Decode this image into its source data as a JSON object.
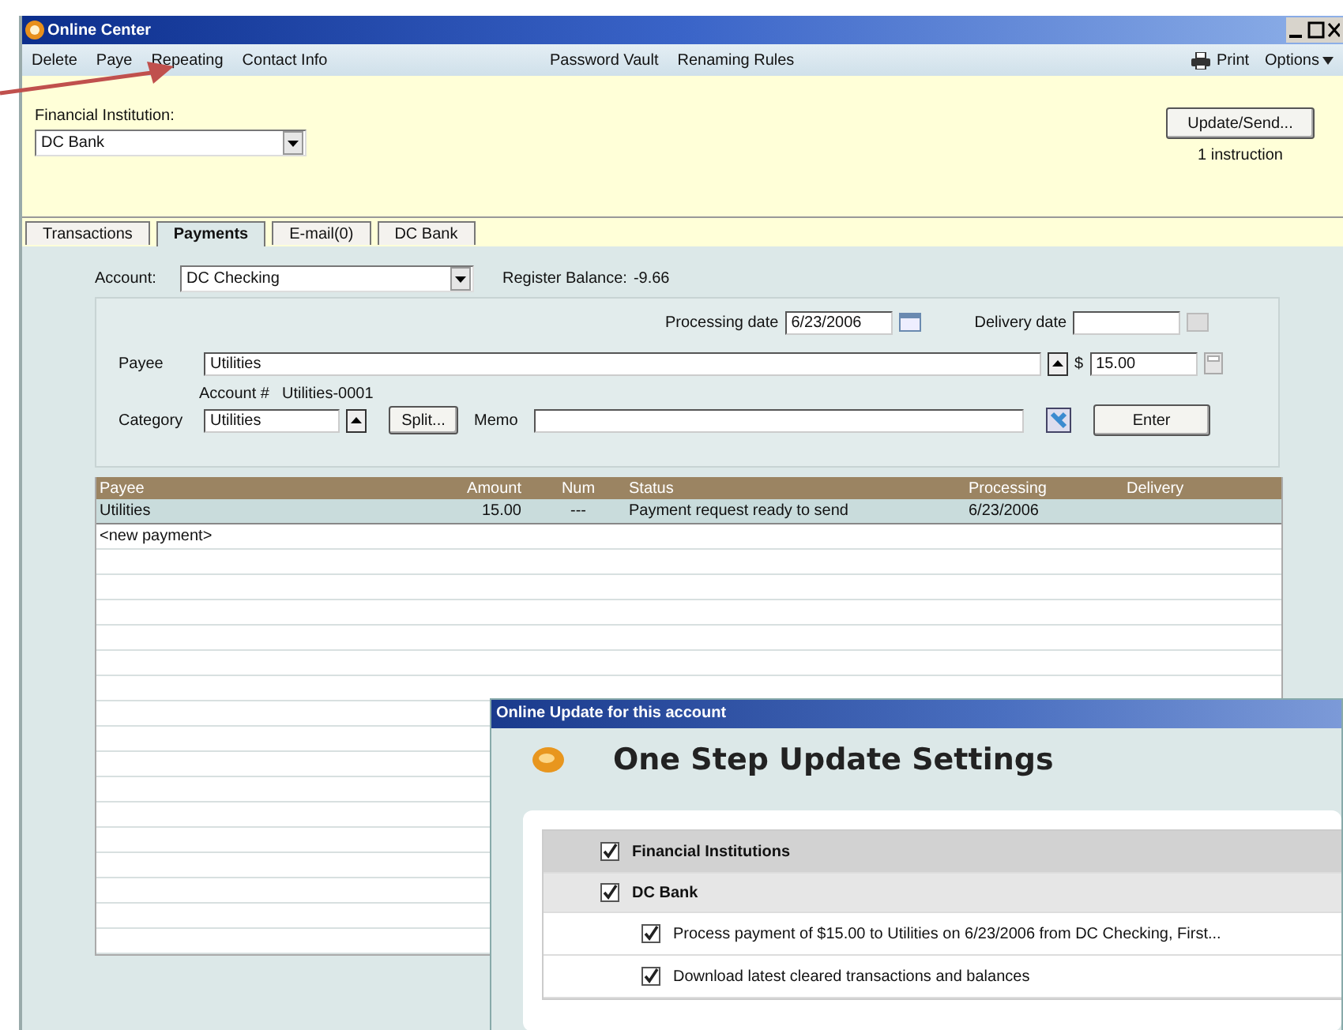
{
  "window": {
    "title": "Online Center"
  },
  "menu": {
    "left": [
      "Delete",
      "Paye",
      "Repeating",
      "Contact Info"
    ],
    "center": [
      "Password Vault",
      "Renaming Rules"
    ],
    "print": "Print",
    "options": "Options"
  },
  "institution": {
    "label": "Financial Institution:",
    "value": "DC Bank"
  },
  "update": {
    "button": "Update/Send...",
    "note": "1 instruction"
  },
  "tabs": [
    {
      "label": "Transactions",
      "selected": false
    },
    {
      "label": "Payments",
      "selected": true
    },
    {
      "label": "E-mail(0)",
      "selected": false
    },
    {
      "label": "DC Bank",
      "selected": false
    }
  ],
  "account": {
    "label": "Account:",
    "value": "DC Checking",
    "balance_label": "Register Balance:",
    "balance": "-9.66"
  },
  "form": {
    "processing_label": "Processing date",
    "processing_date": "6/23/2006",
    "delivery_label": "Delivery date",
    "payee_label": "Payee",
    "payee": "Utilities",
    "currency": "$",
    "amount": "15.00",
    "account_number_label": "Account #",
    "account_number": "Utilities-0001",
    "category_label": "Category",
    "category": "Utilities",
    "split_button": "Split...",
    "memo_label": "Memo",
    "enter_button": "Enter"
  },
  "table": {
    "columns": [
      "Payee",
      "Amount",
      "Num",
      "Status",
      "Processing",
      "Delivery"
    ],
    "rows": [
      {
        "cells": [
          "Utilities",
          "15.00",
          "---",
          "Payment request ready to send",
          "6/23/2006"
        ],
        "selected": true
      },
      {
        "cells": [
          "<new payment>"
        ],
        "selected": false
      }
    ]
  },
  "dialog": {
    "title": "Online Update for this account",
    "heading": "One Step Update Settings",
    "tree": [
      {
        "label": "Financial Institutions",
        "checked": true,
        "children": [
          {
            "label": "DC Bank",
            "checked": true,
            "children": [
              {
                "label": "Process payment of $15.00 to Utilities on 6/23/2006 from DC Checking, First...",
                "checked": true
              },
              {
                "label": "Download latest cleared transactions and balances",
                "checked": true
              }
            ]
          }
        ]
      }
    ]
  }
}
